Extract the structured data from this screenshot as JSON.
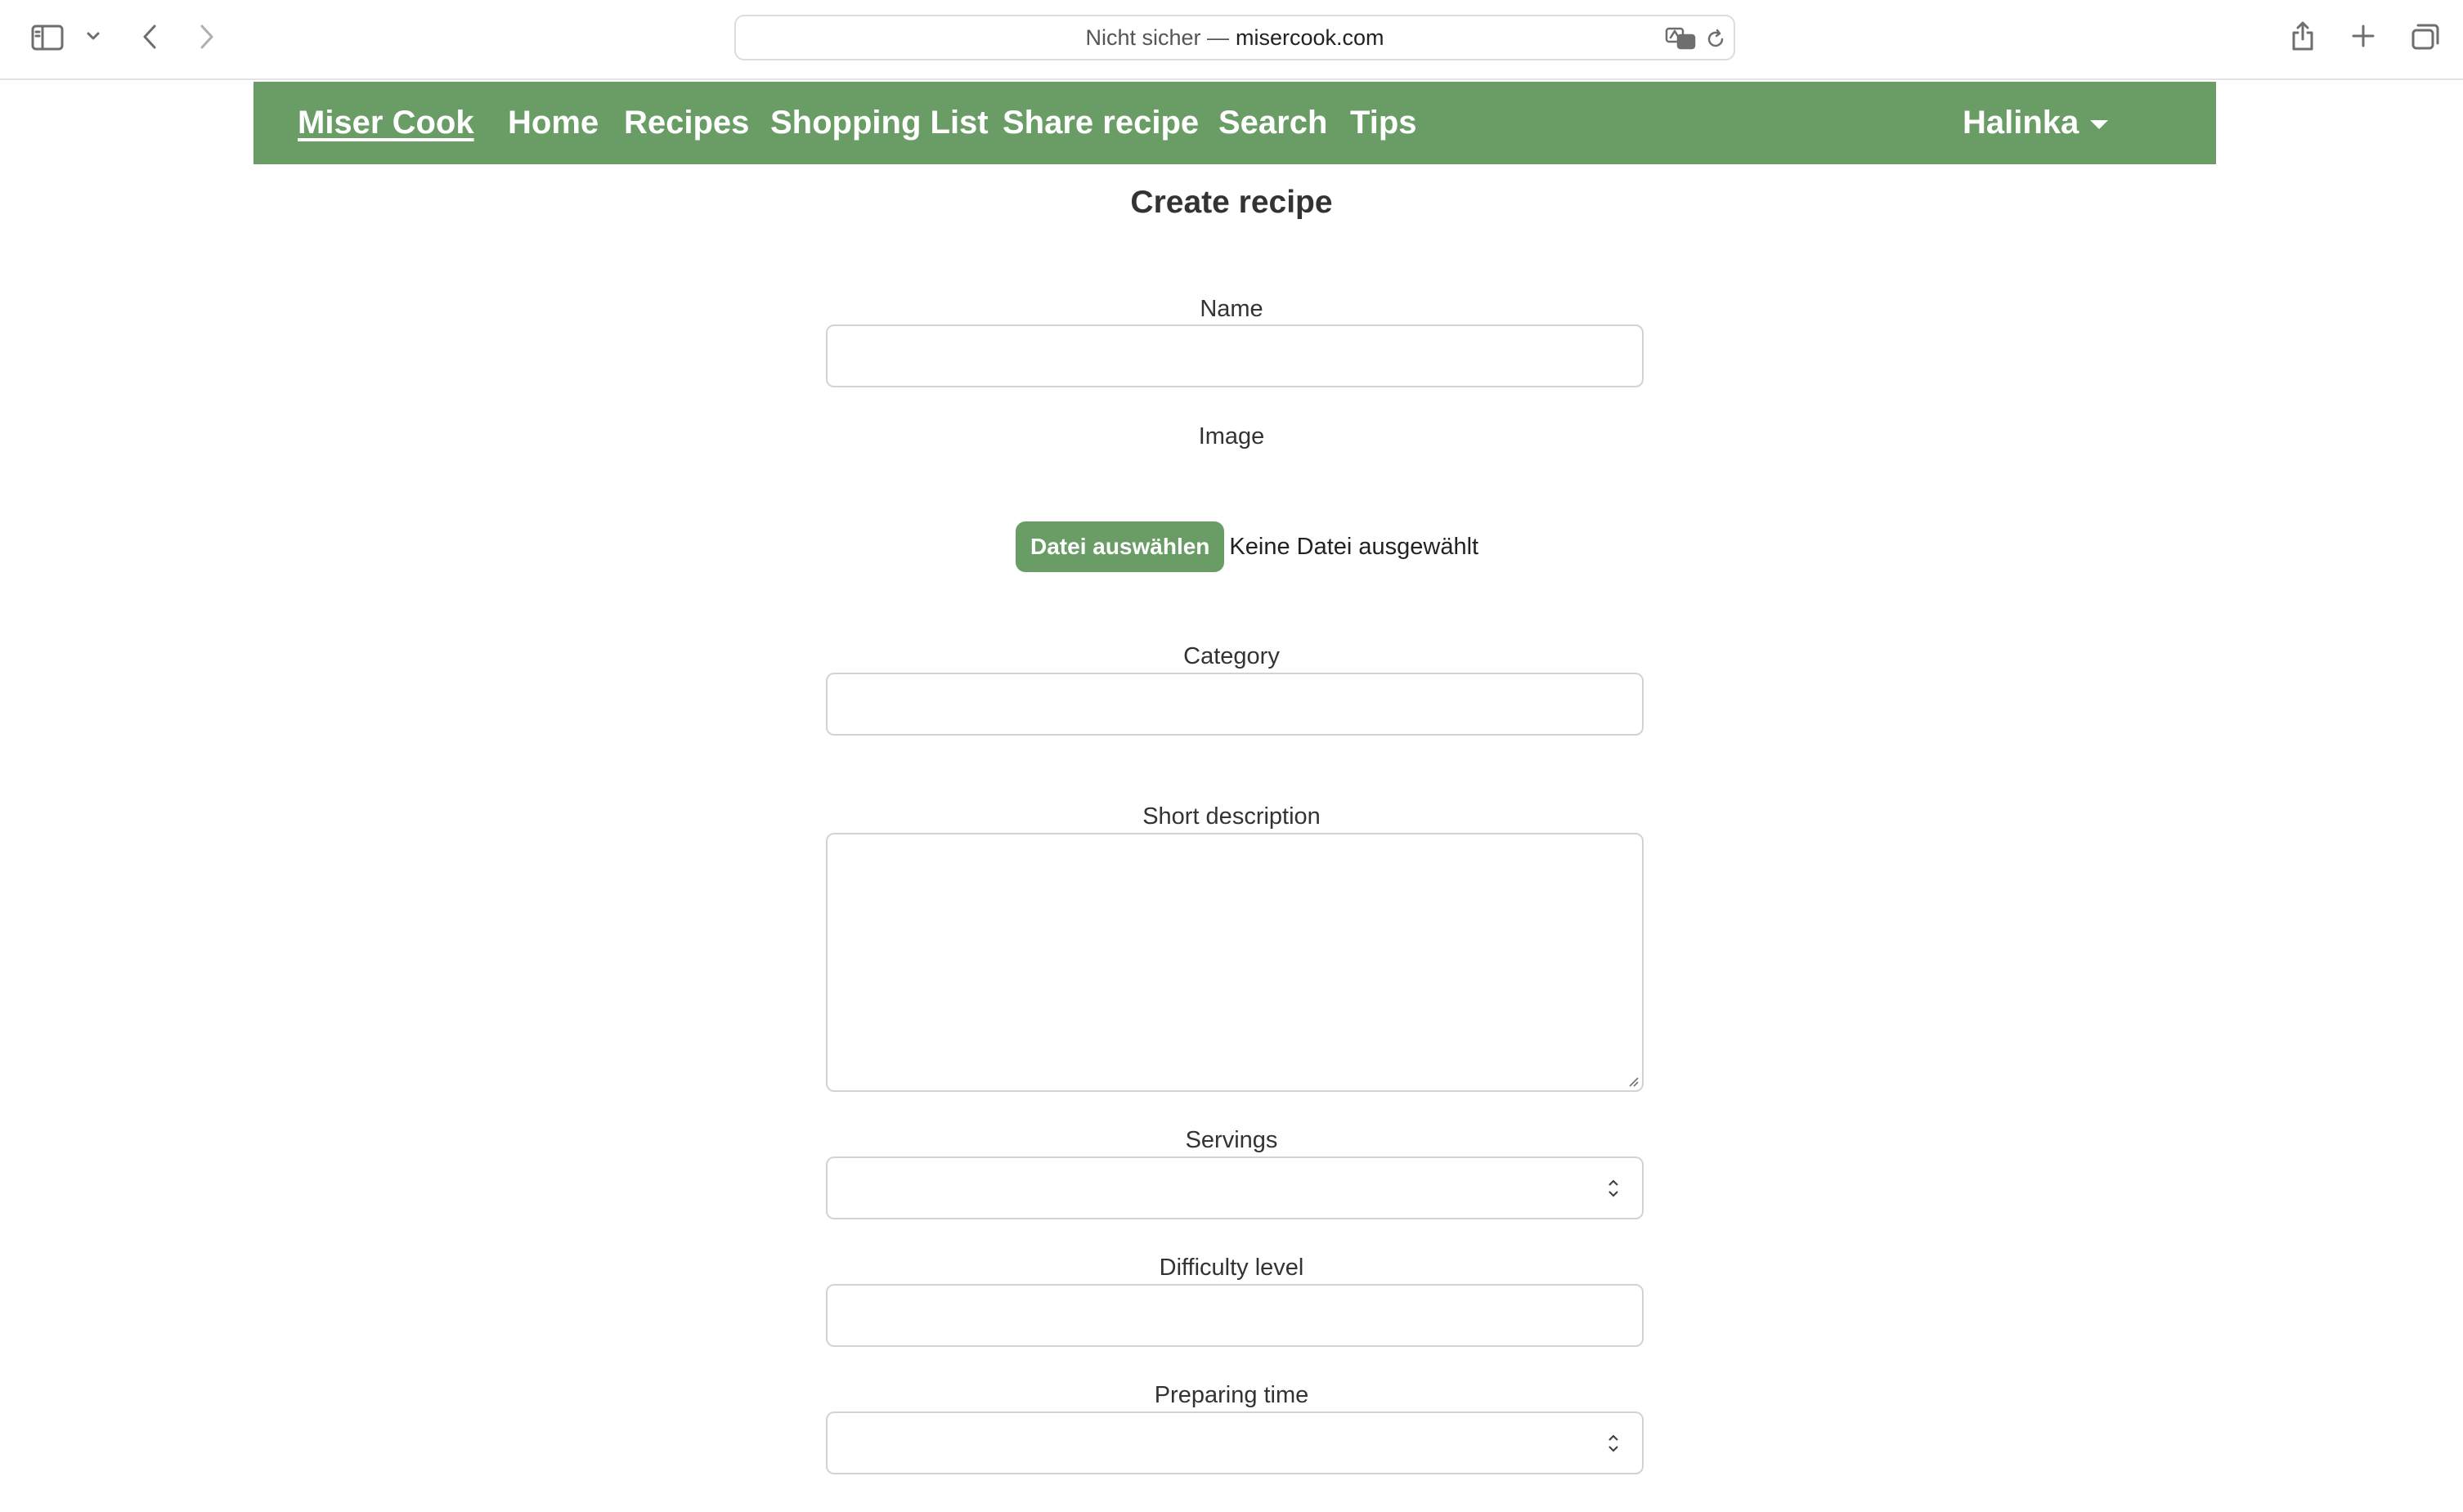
{
  "browser": {
    "url_prefix": "Nicht sicher —",
    "url_domain": "misercook.com"
  },
  "nav": {
    "brand": "Miser Cook",
    "items": [
      {
        "label": "Home"
      },
      {
        "label": "Recipes"
      },
      {
        "label": "Shopping List"
      },
      {
        "label": "Share recipe"
      },
      {
        "label": "Search"
      },
      {
        "label": "Tips"
      }
    ],
    "user": "Halinka"
  },
  "form": {
    "title": "Create recipe",
    "name_label": "Name",
    "image_label": "Image",
    "file_button": "Datei auswählen",
    "file_status": "Keine Datei ausgewählt",
    "category_label": "Category",
    "description_label": "Short description",
    "servings_label": "Servings",
    "difficulty_label": "Difficulty level",
    "prep_time_label": "Preparing time"
  },
  "colors": {
    "brand_green": "#6a9d66"
  }
}
